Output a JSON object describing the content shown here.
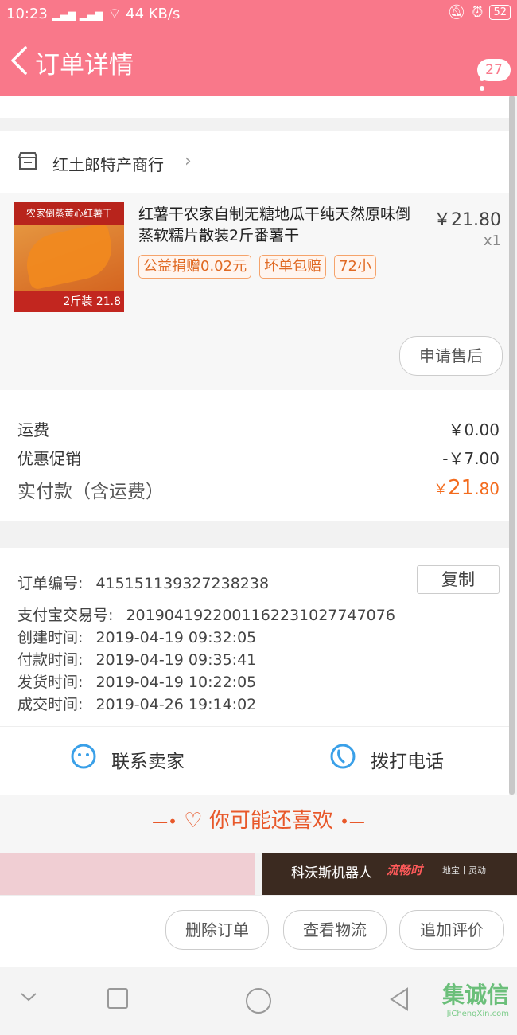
{
  "status_bar": {
    "time": "10:23",
    "net_speed": "44 KB/s",
    "battery": "52"
  },
  "header": {
    "title": "订单详情",
    "badge": "27"
  },
  "shop": {
    "name": "红土郎特产商行"
  },
  "product": {
    "title": "红薯干农家自制无糖地瓜干纯天然原味倒蒸软糯片散装2斤番薯干",
    "price": "￥21.80",
    "qty": "x1",
    "tags": [
      "公益捐赠0.02元",
      "坏单包赔",
      "72小"
    ],
    "image_top_text": "农家倒蒸黄心红薯干",
    "image_bottom_text": "2斤装 21.8",
    "after_sale_button": "申请售后"
  },
  "totals": {
    "shipping_label": "运费",
    "shipping_value": "￥0.00",
    "discount_label": "优惠促销",
    "discount_value": "-￥7.00",
    "paid_label": "实付款（含运费）",
    "paid_currency": "￥",
    "paid_int": "21",
    "paid_dec": ".80"
  },
  "order_info": {
    "copy_button": "复制",
    "rows": [
      {
        "key": "订单编号:",
        "value": "415151139327238238"
      },
      {
        "key": "支付宝交易号:",
        "value": "2019041922001162231027747076"
      },
      {
        "key": "创建时间:",
        "value": "2019-04-19 09:32:05"
      },
      {
        "key": "付款时间:",
        "value": "2019-04-19 09:35:41"
      },
      {
        "key": "发货时间:",
        "value": "2019-04-19 10:22:05"
      },
      {
        "key": "成交时间:",
        "value": "2019-04-26 19:14:02"
      }
    ]
  },
  "actions": {
    "contact_seller": "联系卖家",
    "call_phone": "拨打电话"
  },
  "recommend": {
    "title": "你可能还喜欢",
    "banner_brand": "科沃斯机器人",
    "banner_tag": "流畅时",
    "banner_sub": "地宝丨灵动"
  },
  "bottom_buttons": {
    "delete": "删除订单",
    "logistics": "查看物流",
    "review": "追加评价"
  },
  "watermark": {
    "text": "集诚信",
    "url": "JiChengXin.com"
  },
  "colors": {
    "theme": "#f9788a",
    "accent_orange": "#f36b1d",
    "tag_border": "#f5a36b"
  }
}
